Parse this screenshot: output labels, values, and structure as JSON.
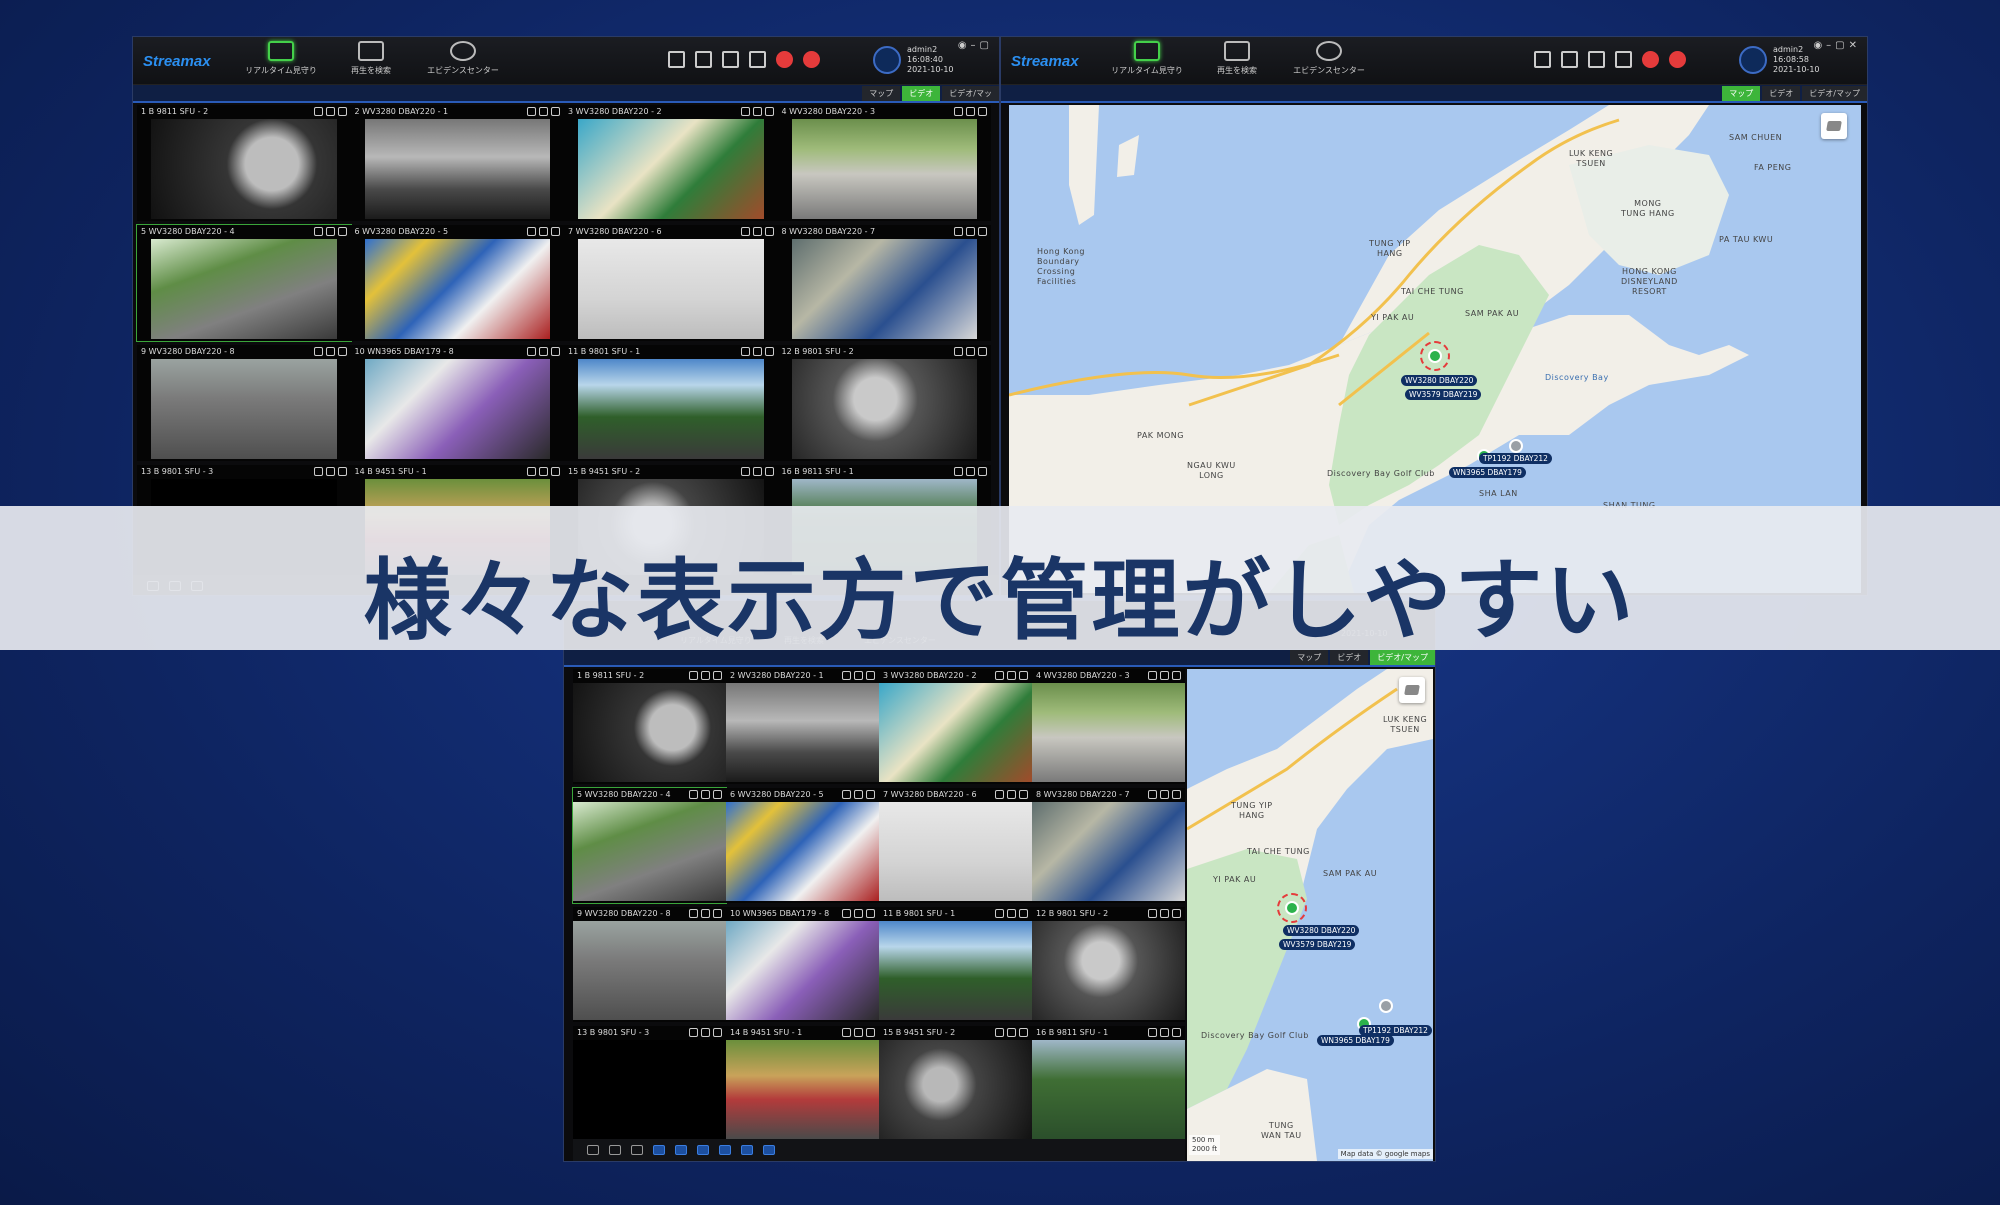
{
  "app": {
    "logo": "Streamax"
  },
  "nav": [
    {
      "label": "リアルタイム見守り"
    },
    {
      "label": "再生を検索"
    },
    {
      "label": "エビデンスセンター"
    }
  ],
  "user": {
    "left": {
      "name": "admin2",
      "time": "16:08:40",
      "date": "2021-10-10"
    },
    "right": {
      "name": "admin2",
      "time": "16:08:58",
      "date": "2021-10-10"
    }
  },
  "view_tabs": {
    "map": "マップ",
    "video": "ビデオ",
    "video_map": "ビデオ/マップ",
    "video_map_short": "ビデオ/マッ"
  },
  "channels": [
    {
      "title": "1 B 9811 SFU - 2"
    },
    {
      "title": "2 WV3280 DBAY220 - 1"
    },
    {
      "title": "3 WV3280 DBAY220 - 2"
    },
    {
      "title": "4 WV3280 DBAY220 - 3"
    },
    {
      "title": "5 WV3280 DBAY220 - 4"
    },
    {
      "title": "6 WV3280 DBAY220 - 5"
    },
    {
      "title": "7 WV3280 DBAY220 - 6"
    },
    {
      "title": "8 WV3280 DBAY220 - 7"
    },
    {
      "title": "9 WV3280 DBAY220 - 8"
    },
    {
      "title": "10 WN3965 DBAY179 - 8"
    },
    {
      "title": "11 B 9801 SFU - 1"
    },
    {
      "title": "12 B 9801 SFU - 2"
    },
    {
      "title": "13 B 9801 SFU - 3"
    },
    {
      "title": "14 B 9451 SFU - 1"
    },
    {
      "title": "15 B 9451 SFU - 2"
    },
    {
      "title": "16 B 9811 SFU - 1"
    }
  ],
  "map": {
    "places": {
      "luk_keng": "LUK KENG\nTSUEN",
      "sam_chuen": "SAM CHUEN",
      "fa_peng": "FA PENG",
      "mong_tung_hang": "MONG\nTUNG HANG",
      "pa_tau_kwu": "PA TAU KWU",
      "hk_disneyland": "HONG KONG\nDISNEYLAND\nRESORT",
      "boundary_crossing": "Hong Kong\nBoundary\nCrossing\nFacilities",
      "tung_yip_hang": "TUNG YIP\nHANG",
      "tai_che_tung": "TAI CHE TUNG",
      "yi_pak_au": "YI PAK AU",
      "sam_pak_au": "SAM PAK AU",
      "discovery_bay": "Discovery Bay",
      "pak_mong": "PAK MONG",
      "ngau_kwu_long": "NGAU KWU\nLONG",
      "discovery_bay_golf": "Discovery Bay Golf Club",
      "sha_lan": "SHA LAN",
      "shan_tung": "SHAN TUNG",
      "tung_wan_tau": "TUNG\nWAN TAU"
    },
    "vehicles": [
      "WV3280 DBAY220",
      "WV3579 DBAY219",
      "TP1192 DBAY212",
      "WN3965 DBAY179"
    ],
    "scale_m": "500 m",
    "scale_ft": "2000 ft",
    "credit": "Map data © google maps"
  },
  "banner": "様々な表示方で管理がしやすい"
}
